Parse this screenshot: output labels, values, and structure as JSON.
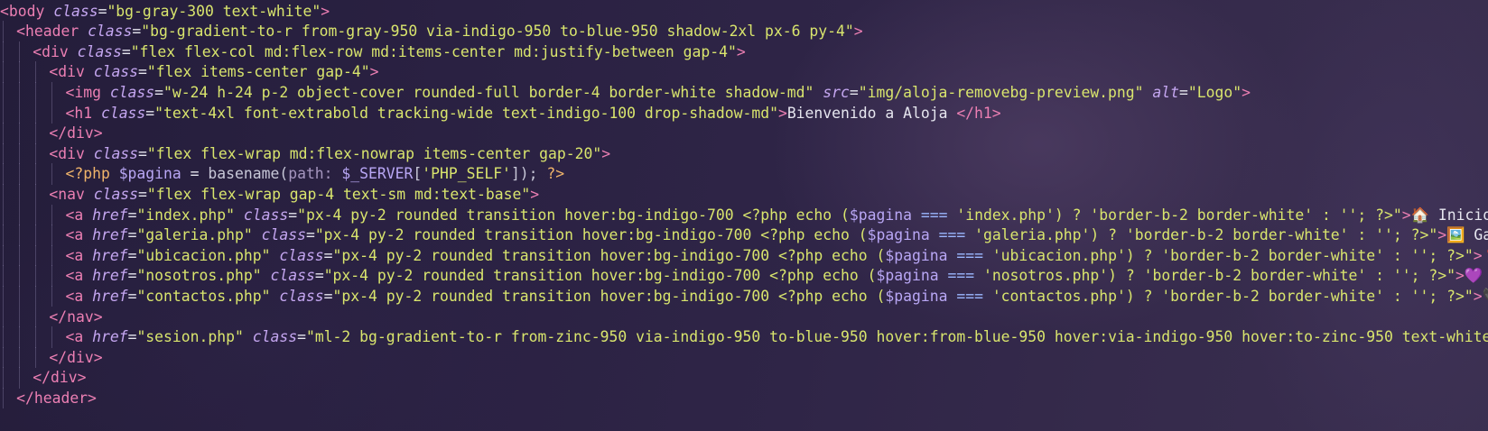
{
  "editor": {
    "lines": [
      {
        "indent": 0,
        "segments": [
          [
            "t",
            "<body "
          ],
          [
            "a",
            "class"
          ],
          [
            "p",
            "="
          ],
          [
            "s",
            "\"bg-gray-300 text-white\""
          ],
          [
            "t",
            ">"
          ]
        ]
      },
      {
        "indent": 1,
        "segments": [
          [
            "t",
            "<header "
          ],
          [
            "a",
            "class"
          ],
          [
            "p",
            "="
          ],
          [
            "s",
            "\"bg-gradient-to-r from-gray-950 via-indigo-950 to-blue-950 shadow-2xl px-6 py-4\""
          ],
          [
            "t",
            ">"
          ]
        ]
      },
      {
        "indent": 2,
        "segments": [
          [
            "t",
            "<div "
          ],
          [
            "a",
            "class"
          ],
          [
            "p",
            "="
          ],
          [
            "s",
            "\"flex flex-col md:flex-row md:items-center md:justify-between gap-4\""
          ],
          [
            "t",
            ">"
          ]
        ]
      },
      {
        "indent": 3,
        "segments": [
          [
            "t",
            "<div "
          ],
          [
            "a",
            "class"
          ],
          [
            "p",
            "="
          ],
          [
            "s",
            "\"flex items-center gap-4\""
          ],
          [
            "t",
            ">"
          ]
        ]
      },
      {
        "indent": 4,
        "segments": [
          [
            "t",
            "<img "
          ],
          [
            "a",
            "class"
          ],
          [
            "p",
            "="
          ],
          [
            "s",
            "\"w-24 h-24 p-2 object-cover rounded-full border-4 border-white shadow-md\" "
          ],
          [
            "a",
            "src"
          ],
          [
            "p",
            "="
          ],
          [
            "s",
            "\"img/aloja-removebg-preview.png\" "
          ],
          [
            "a",
            "alt"
          ],
          [
            "p",
            "="
          ],
          [
            "s",
            "\"Logo\""
          ],
          [
            "t",
            ">"
          ]
        ]
      },
      {
        "indent": 4,
        "segments": [
          [
            "t",
            "<h1 "
          ],
          [
            "a",
            "class"
          ],
          [
            "p",
            "="
          ],
          [
            "s",
            "\"text-4xl font-extrabold tracking-wide text-indigo-100 drop-shadow-md\""
          ],
          [
            "t",
            ">"
          ],
          [
            "p",
            "Bienvenido a Aloja "
          ],
          [
            "t",
            "</h1>"
          ]
        ]
      },
      {
        "indent": 3,
        "segments": [
          [
            "t",
            "</div>"
          ]
        ]
      },
      {
        "indent": 3,
        "segments": [
          [
            "t",
            "<div "
          ],
          [
            "a",
            "class"
          ],
          [
            "p",
            "="
          ],
          [
            "s",
            "\"flex flex-wrap md:flex-nowrap items-center gap-20\""
          ],
          [
            "t",
            ">"
          ]
        ]
      },
      {
        "indent": 4,
        "segments": [
          [
            "k",
            "<?php "
          ],
          [
            "v",
            "$pagina "
          ],
          [
            "p",
            "= "
          ],
          [
            "m",
            "basename("
          ],
          [
            "h",
            "path: "
          ],
          [
            "v",
            "$_SERVER"
          ],
          [
            "m",
            "["
          ],
          [
            "s",
            "'PHP_SELF'"
          ],
          [
            "m",
            "]); "
          ],
          [
            "k",
            "?>"
          ]
        ]
      },
      {
        "indent": 3,
        "segments": [
          [
            "t",
            "<nav "
          ],
          [
            "a",
            "class"
          ],
          [
            "p",
            "="
          ],
          [
            "s",
            "\"flex flex-wrap gap-4 text-sm md:text-base\""
          ],
          [
            "t",
            ">"
          ]
        ]
      },
      {
        "indent": 4,
        "segments": [
          [
            "t",
            "<a "
          ],
          [
            "a",
            "href"
          ],
          [
            "p",
            "="
          ],
          [
            "s",
            "\"index.php\" "
          ],
          [
            "a",
            "class"
          ],
          [
            "p",
            "="
          ],
          [
            "s",
            "\"px-4 py-2 rounded transition hover:bg-indigo-700 <?php echo ("
          ],
          [
            "v",
            "$pagina "
          ],
          [
            "op",
            "=== "
          ],
          [
            "s",
            "'index.php'"
          ],
          [
            "s",
            ") ? 'border-b-2 border-white' : ''; ?>\""
          ],
          [
            "t",
            ">"
          ],
          [
            "p",
            "🏠 Inicio"
          ],
          [
            "t",
            "</"
          ]
        ]
      },
      {
        "indent": 4,
        "segments": [
          [
            "t",
            "<a "
          ],
          [
            "a",
            "href"
          ],
          [
            "p",
            "="
          ],
          [
            "s",
            "\"galeria.php\" "
          ],
          [
            "a",
            "class"
          ],
          [
            "p",
            "="
          ],
          [
            "s",
            "\"px-4 py-2 rounded transition hover:bg-indigo-700 <?php echo ("
          ],
          [
            "v",
            "$pagina "
          ],
          [
            "op",
            "=== "
          ],
          [
            "s",
            "'galeria.php'"
          ],
          [
            "s",
            ") ? 'border-b-2 border-white' : ''; ?>\""
          ],
          [
            "t",
            ">"
          ],
          [
            "p",
            "🖼️ Gale"
          ]
        ]
      },
      {
        "indent": 4,
        "segments": [
          [
            "t",
            "<a "
          ],
          [
            "a",
            "href"
          ],
          [
            "p",
            "="
          ],
          [
            "s",
            "\"ubicacion.php\" "
          ],
          [
            "a",
            "class"
          ],
          [
            "p",
            "="
          ],
          [
            "s",
            "\"px-4 py-2 rounded transition hover:bg-indigo-700 <?php echo ("
          ],
          [
            "v",
            "$pagina "
          ],
          [
            "op",
            "=== "
          ],
          [
            "s",
            "'ubicacion.php'"
          ],
          [
            "s",
            ") ? 'border-b-2 border-white' : ''; ?>\""
          ],
          [
            "t",
            ">"
          ],
          [
            "p",
            "📍"
          ]
        ]
      },
      {
        "indent": 4,
        "segments": [
          [
            "t",
            "<a "
          ],
          [
            "a",
            "href"
          ],
          [
            "p",
            "="
          ],
          [
            "s",
            "\"nosotros.php\" "
          ],
          [
            "a",
            "class"
          ],
          [
            "p",
            "="
          ],
          [
            "s",
            "\"px-4 py-2 rounded transition hover:bg-indigo-700 <?php echo ("
          ],
          [
            "v",
            "$pagina "
          ],
          [
            "op",
            "=== "
          ],
          [
            "s",
            "'nosotros.php'"
          ],
          [
            "s",
            ") ? 'border-b-2 border-white' : ''; ?>\""
          ],
          [
            "t",
            ">"
          ],
          [
            "p",
            "💜 No"
          ]
        ]
      },
      {
        "indent": 4,
        "segments": [
          [
            "t",
            "<a "
          ],
          [
            "a",
            "href"
          ],
          [
            "p",
            "="
          ],
          [
            "s",
            "\"contactos.php\" "
          ],
          [
            "a",
            "class"
          ],
          [
            "p",
            "="
          ],
          [
            "s",
            "\"px-4 py-2 rounded transition hover:bg-indigo-700 <?php echo ("
          ],
          [
            "v",
            "$pagina "
          ],
          [
            "op",
            "=== "
          ],
          [
            "s",
            "'contactos.php'"
          ],
          [
            "s",
            ") ? 'border-b-2 border-white' : ''; ?>\""
          ],
          [
            "t",
            ">"
          ],
          [
            "p",
            "📞"
          ]
        ]
      },
      {
        "indent": 3,
        "segments": [
          [
            "t",
            "</nav>"
          ]
        ]
      },
      {
        "indent": 4,
        "segments": [
          [
            "t",
            "<a "
          ],
          [
            "a",
            "href"
          ],
          [
            "p",
            "="
          ],
          [
            "s",
            "\"sesion.php\" "
          ],
          [
            "a",
            "class"
          ],
          [
            "p",
            "="
          ],
          [
            "s",
            "\"ml-2 bg-gradient-to-r from-zinc-950 via-indigo-950 to-blue-950 hover:from-blue-950 hover:via-indigo-950 hover:to-zinc-950 text-white p"
          ]
        ]
      },
      {
        "indent": 3,
        "segments": [
          [
            "t",
            "</div>"
          ]
        ]
      },
      {
        "indent": 2,
        "segments": [
          [
            "t",
            "</div>"
          ]
        ]
      },
      {
        "indent": 1,
        "segments": [
          [
            "t",
            "</header>"
          ]
        ]
      }
    ]
  }
}
